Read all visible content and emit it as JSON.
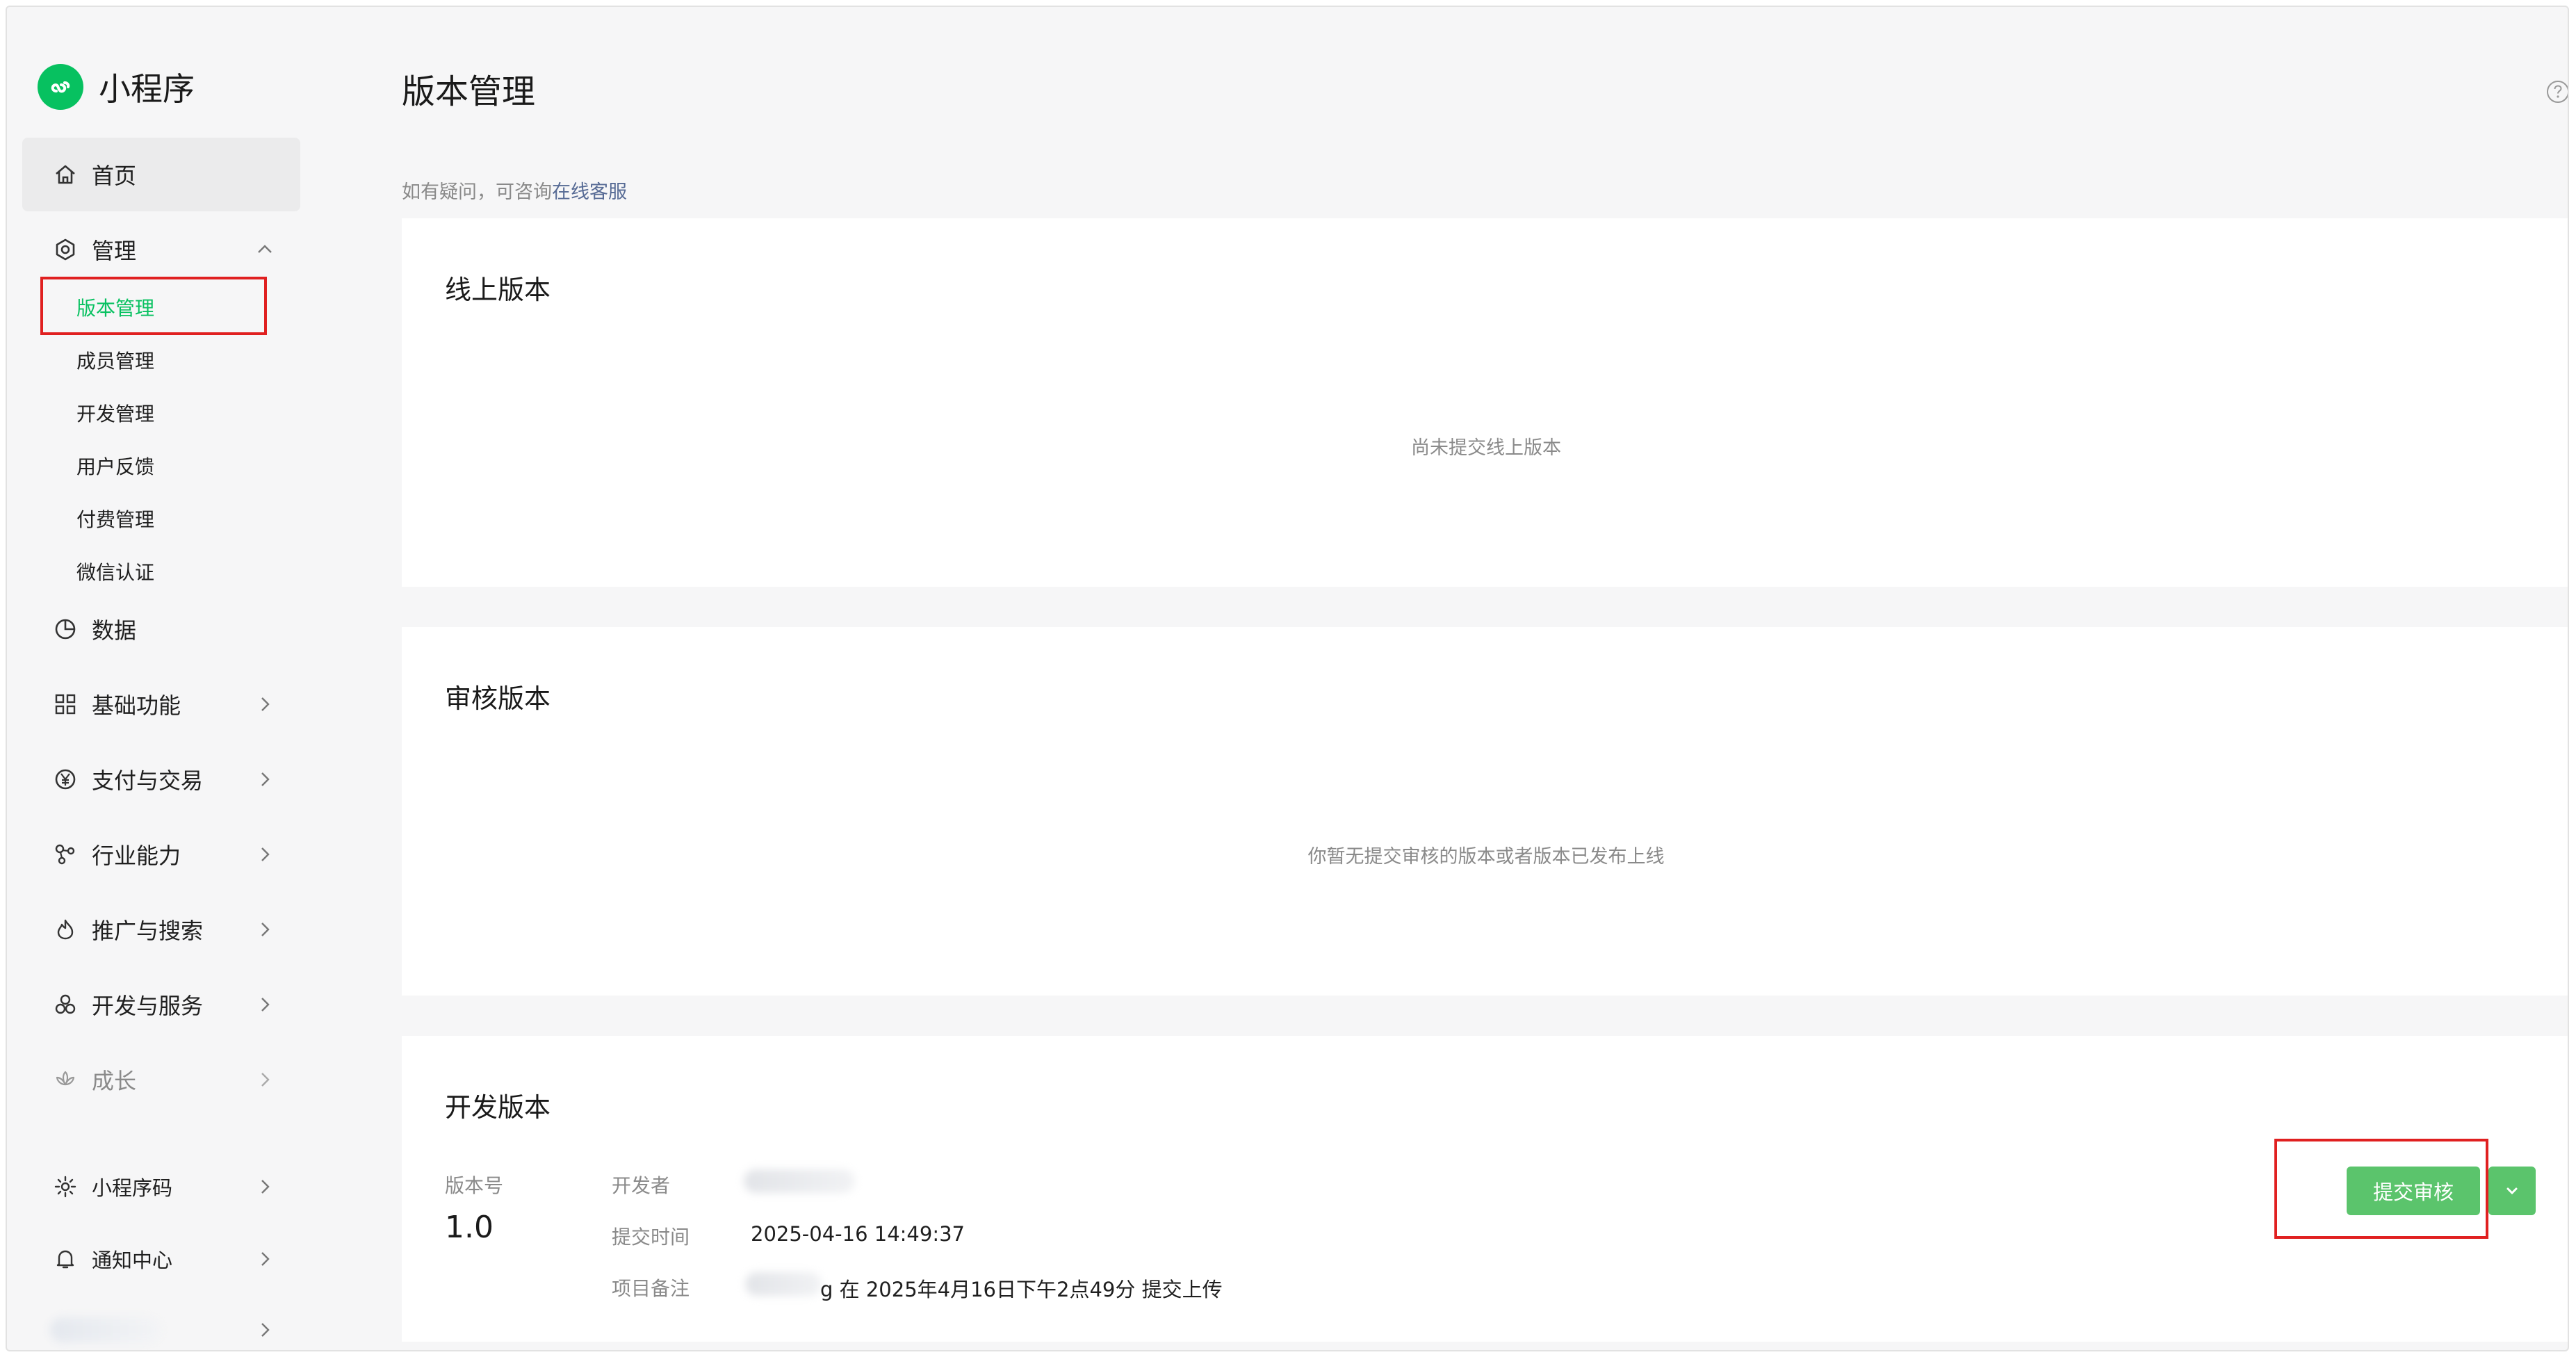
{
  "app": {
    "name": "小程序"
  },
  "sidebar": {
    "home": "首页",
    "manage": {
      "label": "管理",
      "items": [
        "版本管理",
        "成员管理",
        "开发管理",
        "用户反馈",
        "付费管理",
        "微信认证"
      ]
    },
    "data": "数据",
    "groups": [
      "基础功能",
      "支付与交易",
      "行业能力",
      "推广与搜索",
      "开发与服务",
      "成长"
    ],
    "bottom": [
      "小程序码",
      "通知中心"
    ]
  },
  "page": {
    "title": "版本管理",
    "hint_prefix": "如有疑问，可咨询",
    "hint_link": "在线客服"
  },
  "cards": {
    "online": {
      "title": "线上版本",
      "empty": "尚未提交线上版本"
    },
    "review": {
      "title": "审核版本",
      "empty": "你暂无提交审核的版本或者版本已发布上线"
    },
    "dev": {
      "title": "开发版本",
      "version_label": "版本号",
      "version_value": "1.0",
      "developer_label": "开发者",
      "time_label": "提交时间",
      "time_value": "2025-04-16 14:49:37",
      "note_label": "项目备注",
      "note_value": "g 在 2025年4月16日下午2点49分 提交上传",
      "submit_button": "提交审核"
    }
  },
  "colors": {
    "accent": "#07c160",
    "button": "#5bc46c",
    "highlight_box": "#e02020",
    "link": "#576b95"
  }
}
